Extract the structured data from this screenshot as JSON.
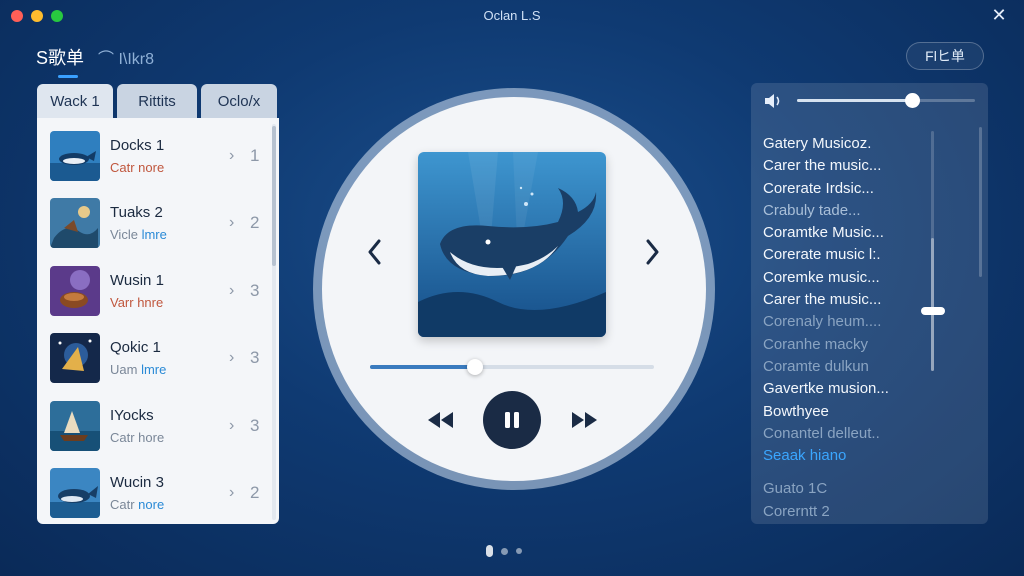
{
  "window": {
    "title": "Oclan L.S"
  },
  "header": {
    "main_tab": "S歌单",
    "secondary_tab": "⌒ I\\Ikr8",
    "right_button": "Flヒ单"
  },
  "left_panel": {
    "tabs": [
      "Wack 1",
      "Rittits",
      "Oclo/x"
    ],
    "items": [
      {
        "title": "Docks 1",
        "sub": "Catr nore",
        "sub_accent": "",
        "number": "1"
      },
      {
        "title": "Tuaks 2",
        "sub": "Vicle ",
        "sub_accent": "lmre",
        "number": "2"
      },
      {
        "title": "Wusin 1",
        "sub": "Varr hnre",
        "sub_accent": "",
        "number": "3"
      },
      {
        "title": "Qokic 1",
        "sub": "Uam ",
        "sub_accent": "lmre",
        "number": "3"
      },
      {
        "title": "IYocks",
        "sub": "Catr hore",
        "sub_accent": "",
        "number": "3"
      },
      {
        "title": "Wucin 3",
        "sub": "Catr ",
        "sub_accent": "nore",
        "number": "2"
      }
    ]
  },
  "player": {
    "progress_percent": 37,
    "state": "playing"
  },
  "right_panel": {
    "volume_percent": 65,
    "lyrics": [
      {
        "text": "Gatery Musicoz.",
        "style": "bright"
      },
      {
        "text": "Carer the music...",
        "style": "bright"
      },
      {
        "text": "Corerate Irdsic...",
        "style": "bright"
      },
      {
        "text": "Crabuly tade...",
        "style": "dim"
      },
      {
        "text": "Coramtke Music...",
        "style": "bright"
      },
      {
        "text": "Corerate music l:.",
        "style": "bright"
      },
      {
        "text": "Coremke music...",
        "style": "bright"
      },
      {
        "text": "Carer the music...",
        "style": "bright"
      },
      {
        "text": "Corenaly heum....",
        "style": "faint"
      },
      {
        "text": "Coranhe macky",
        "style": "faint"
      },
      {
        "text": "Coramte dulkun",
        "style": "faint"
      },
      {
        "text": "Gavertke musion...",
        "style": "bright"
      },
      {
        "text": "Bowthyee",
        "style": "bright"
      },
      {
        "text": "Conantel delleut..",
        "style": "faint"
      },
      {
        "text": "Seaak hiano",
        "style": "active"
      },
      {
        "text": "",
        "style": "faint"
      },
      {
        "text": "Guato 1C",
        "style": "faint"
      },
      {
        "text": "Corerntt 2",
        "style": "faint"
      }
    ]
  },
  "colors": {
    "accent": "#3aa6ff",
    "play_button": "#1a2b45",
    "background": "#0f3a72"
  },
  "icons": {
    "close": "close-icon",
    "volume": "speaker-icon",
    "prev_track": "rewind-icon",
    "next_track": "fast-forward-icon",
    "play_pause": "pause-icon",
    "chevron": "chevron-right-icon"
  }
}
